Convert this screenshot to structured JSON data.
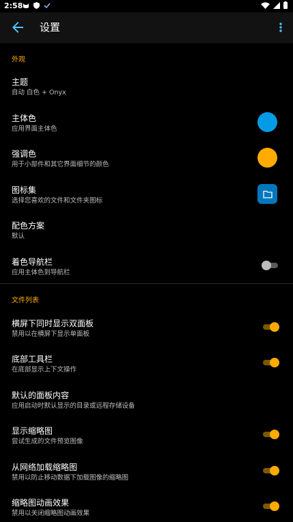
{
  "status_bar": {
    "time": "2:58",
    "left_icons": [
      "cat-icon",
      "shield-icon",
      "check-icon"
    ],
    "right_icons": [
      "wifi-icon",
      "signal-icon",
      "battery-icon"
    ]
  },
  "app_bar": {
    "title": "设置",
    "back_icon": "arrow-left-icon",
    "more_icon": "more-vert-icon"
  },
  "colors": {
    "accent": "#ffab00",
    "primary": "#039be5",
    "icon_set_bg": "#0277bd",
    "background": "#000000",
    "appbar": "#121212"
  },
  "sections": {
    "appearance": {
      "header": "外观",
      "items": [
        {
          "title": "主题",
          "summary": "自动 白色 + Onyx"
        },
        {
          "title": "主体色",
          "summary": "应用界面主体色",
          "color": "#039be5"
        },
        {
          "title": "强调色",
          "summary": "用于小部件和其它界面细节的颜色",
          "color": "#ffab00"
        },
        {
          "title": "图标集",
          "summary": "选择您喜欢的文件和文件夹图标",
          "icon": "folder-icon"
        },
        {
          "title": "配色方案",
          "summary": "默认"
        },
        {
          "title": "着色导航栏",
          "summary": "应用主体色到导航栏",
          "toggle": false
        }
      ]
    },
    "file_list": {
      "header": "文件列表",
      "items": [
        {
          "title": "横屏下同时显示双面板",
          "summary": "禁用以在横屏下显示单面板",
          "toggle": true
        },
        {
          "title": "底部工具栏",
          "summary": "在底部显示上下文操作",
          "toggle": true
        },
        {
          "title": "默认的面板内容",
          "summary": "应用启动时默认显示的目录或远程存储设备"
        },
        {
          "title": "显示缩略图",
          "summary": "尝试生成的文件预览图像",
          "toggle": true
        },
        {
          "title": "从网络加载缩略图",
          "summary": "禁用以防止移动数据下加载图像的缩略图",
          "toggle": true
        },
        {
          "title": "缩略图动画效果",
          "summary": "禁用以关闭缩略图动画效果",
          "toggle": true
        }
      ]
    }
  }
}
